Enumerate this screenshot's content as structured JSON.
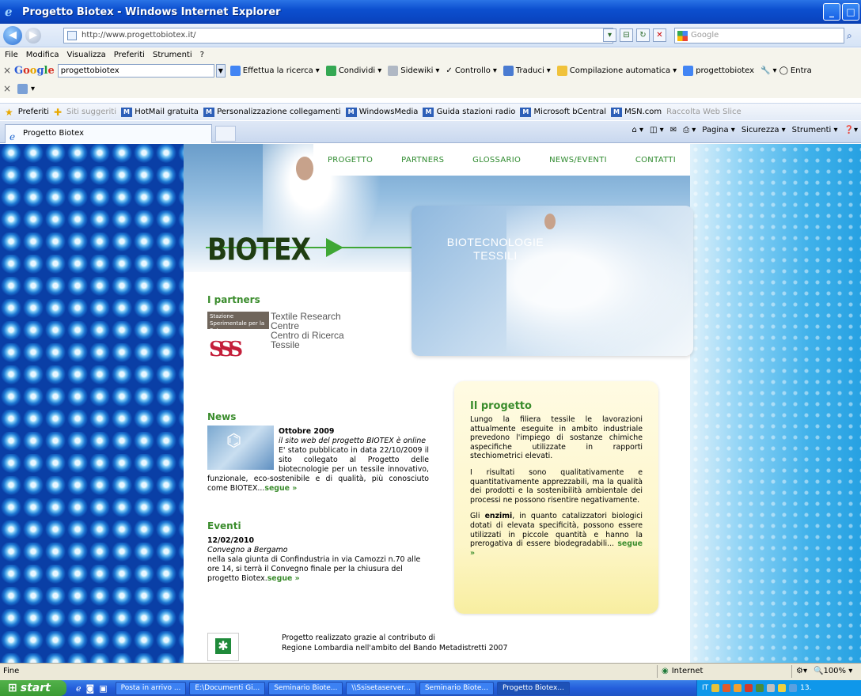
{
  "window": {
    "title": "Progetto Biotex - Windows Internet Explorer",
    "controls": [
      "_",
      "□"
    ]
  },
  "address": {
    "url": "http://www.progettobiotex.it/",
    "search_placeholder": "Google"
  },
  "menu": [
    "File",
    "Modifica",
    "Visualizza",
    "Preferiti",
    "Strumenti",
    "?"
  ],
  "google_toolbar": {
    "query": "progettobiotex",
    "items": [
      "Effettua la ricerca",
      "Condividi",
      "Sidewiki",
      "Controllo",
      "Traduci",
      "Compilazione automatica",
      "progettobiotex",
      "Entra"
    ]
  },
  "favorites": {
    "label": "Preferiti",
    "items": [
      "Siti suggeriti",
      "HotMail gratuita",
      "Personalizzazione collegamenti",
      "WindowsMedia",
      "Guida stazioni radio",
      "Microsoft bCentral",
      "MSN.com",
      "Raccolta Web Slice"
    ]
  },
  "tab": {
    "title": "Progetto Biotex"
  },
  "command_bar": [
    "Pagina",
    "Sicurezza",
    "Strumenti"
  ],
  "site": {
    "nav": [
      "PROGETTO",
      "PARTNERS",
      "GLOSSARIO",
      "NEWS/EVENTI",
      "CONTATTI"
    ],
    "logo": "BIOTEX",
    "tagline_line1": "BIOTECNOLOGIE",
    "tagline_line2": "TESSILI",
    "partners": {
      "heading": "I partners",
      "logo_text": "Stazione Sperimentale per la Seta",
      "logo_mark": "SSS",
      "lines": [
        "Textile Research",
        "Centre",
        "Centro di Ricerca",
        "Tessile"
      ]
    },
    "news": {
      "heading": "News",
      "date": "Ottobre 2009",
      "subtitle": "il sito web del progetto BIOTEX è online",
      "body": "E' stato pubblicato in data 22/10/2009 il sito collegato al Progetto delle biotecnologie per un tessile innovativo, funzionale, eco-sostenibile e di qualità, più conosciuto come BIOTEX...",
      "more": "segue »"
    },
    "eventi": {
      "heading": "Eventi",
      "date": "12/02/2010",
      "subtitle": "Convegno a Bergamo",
      "body": "nella sala giunta di Confindustria in via Camozzi n.70 alle ore 14, si terrà il Convegno finale per la chiusura del progetto Biotex.",
      "more": "segue »"
    },
    "progetto": {
      "heading": "Il progetto",
      "p1": "Lungo la filiera tessile le lavorazioni attualmente eseguite in ambito industriale prevedono l'impiego di sostanze chimiche aspecifiche utilizzate in rapporti stechiometrici elevati.",
      "p2": "I risultati sono qualitativamente e quantitativamente apprezzabili, ma la qualità dei prodotti e la sostenibilità ambientale dei processi ne possono risentire negativamente.",
      "p3_prefix": "Gli ",
      "p3_bold": "enzimi",
      "p3_rest": ", in quanto catalizzatori biologici dotati di elevata specificità, possono essere utilizzati in piccole quantità e hanno la prerogativa di essere biodegradabili...",
      "more": "segue »"
    },
    "footer": {
      "line1": "Progetto realizzato grazie al contributo di",
      "line2": "Regione Lombardia nell'ambito del Bando Metadistretti 2007"
    }
  },
  "status": {
    "text": "Fine",
    "zone": "Internet",
    "zoom": "100%"
  },
  "taskbar": {
    "start": "start",
    "tasks": [
      "Posta in arrivo ...",
      "E:\\Documenti Gi...",
      "Seminario Biote...",
      "\\\\Ssisetaserver...",
      "Seminario Biote...",
      "Progetto Biotex..."
    ],
    "lang": "IT",
    "clock": "13."
  }
}
